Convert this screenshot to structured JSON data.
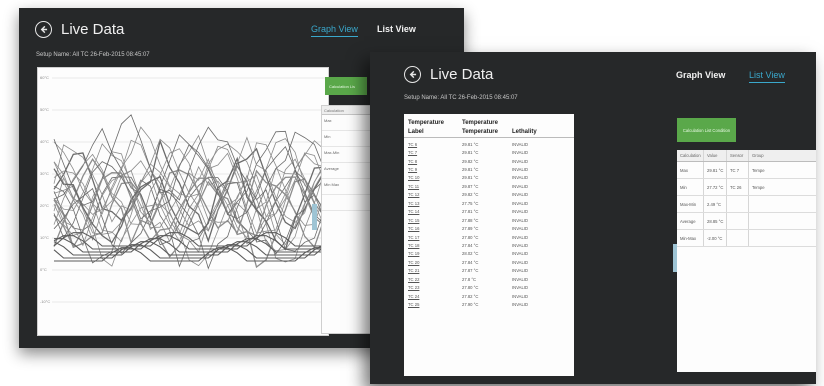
{
  "graph_window": {
    "title": "Live Data",
    "tab_graph": "Graph View",
    "tab_list": "List View",
    "setup_name": "Setup Name: All TC 26-Feb-2015 08:45:07",
    "calc_button": "Calculation Lis",
    "stats_header": "Calculation",
    "stats_rows": [
      "Max",
      "Min",
      "Max-Min",
      "Average",
      "Min Max"
    ],
    "y_labels": [
      "60°C",
      "50°C",
      "40°C",
      "30°C",
      "20°C",
      "10°C",
      "0°C",
      "-10°C"
    ]
  },
  "list_window": {
    "title": "Live Data",
    "tab_graph": "Graph View",
    "tab_list": "List View",
    "setup_name": "Setup Name: All TC 26-Feb-2015 08:45:07",
    "columns_top": [
      "Temperature",
      "Temperature",
      ""
    ],
    "columns_bottom": [
      "Label",
      "Temperature",
      "Lethality"
    ],
    "rows": [
      [
        "TC 6",
        "29.81 °C",
        "INVALID"
      ],
      [
        "TC 7",
        "29.81 °C",
        "INVALID"
      ],
      [
        "TC 8",
        "29.82 °C",
        "INVALID"
      ],
      [
        "TC 9",
        "29.81 °C",
        "INVALID"
      ],
      [
        "TC 10",
        "29.81 °C",
        "INVALID"
      ],
      [
        "TC 11",
        "29.87 °C",
        "INVALID"
      ],
      [
        "TC 12",
        "29.82 °C",
        "INVALID"
      ],
      [
        "TC 13",
        "27.75 °C",
        "INVALID"
      ],
      [
        "TC 14",
        "27.81 °C",
        "INVALID"
      ],
      [
        "TC 15",
        "27.88 °C",
        "INVALID"
      ],
      [
        "TC 16",
        "27.89 °C",
        "INVALID"
      ],
      [
        "TC 17",
        "27.80 °C",
        "INVALID"
      ],
      [
        "TC 18",
        "27.84 °C",
        "INVALID"
      ],
      [
        "TC 19",
        "28.02 °C",
        "INVALID"
      ],
      [
        "TC 20",
        "27.84 °C",
        "INVALID"
      ],
      [
        "TC 21",
        "27.87 °C",
        "INVALID"
      ],
      [
        "TC 22",
        "27.8 °C",
        "INVALID"
      ],
      [
        "TC 23",
        "27.80 °C",
        "INVALID"
      ],
      [
        "TC 24",
        "27.82 °C",
        "INVALID"
      ],
      [
        "TC 25",
        "27.90 °C",
        "INVALID"
      ]
    ],
    "calc_button": "Calculation List Condition",
    "stats_columns": [
      "Calculation",
      "Value",
      "Sensor",
      "Group"
    ],
    "stats_rows": [
      [
        "Max",
        "29.81 °C",
        "TC 7",
        "Tempe"
      ],
      [
        "Min",
        "27.72 °C",
        "TC 26",
        "Tempe"
      ],
      [
        "Max-Min",
        "2.49 °C",
        "",
        ""
      ],
      [
        "Average",
        "28.85 °C",
        "",
        ""
      ],
      [
        "Min-Max",
        "-2.00 °C",
        "",
        ""
      ]
    ]
  },
  "colors": {
    "window_bg": "#262829",
    "accent": "#3aa8cc",
    "button_green": "#5aa84a"
  }
}
